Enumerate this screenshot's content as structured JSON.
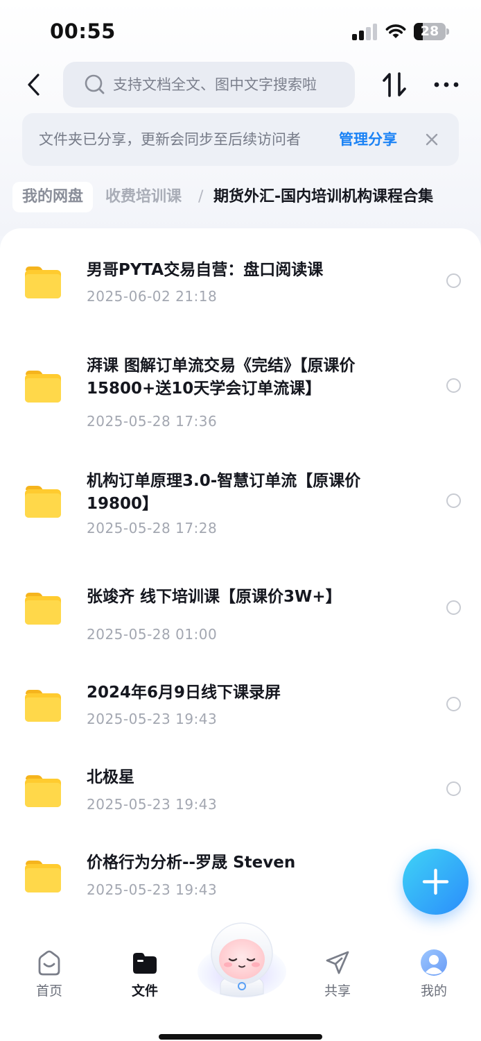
{
  "status_bar": {
    "time": "00:55",
    "battery": "28",
    "battery_level": 0.28
  },
  "search": {
    "placeholder": "支持文档全文、图中文字搜索啦"
  },
  "share_banner": {
    "message": "文件夹已分享，更新会同步至后续访问者",
    "action": "管理分享"
  },
  "breadcrumb": {
    "items": [
      {
        "label": "我的网盘"
      },
      {
        "label": "收费培训课"
      },
      {
        "label": "期货外汇-国内培训机构课程合集"
      }
    ],
    "separator": "/"
  },
  "files": [
    {
      "title": "男哥PYTA交易自营：盘口阅读课",
      "date": "2025-06-02 21:18"
    },
    {
      "title": "湃课 图解订单流交易《完结》【原课价15800+送10天学会订单流课】",
      "date": "2025-05-28 17:36"
    },
    {
      "title": "机构订单原理3.0-智慧订单流【原课价19800】",
      "date": "2025-05-28 17:28"
    },
    {
      "title": "张竣齐 线下培训课【原课价3W+】",
      "date": "2025-05-28 01:00"
    },
    {
      "title": "2024年6月9日线下课录屏",
      "date": "2025-05-23 19:43"
    },
    {
      "title": "北极星",
      "date": "2025-05-23 19:43"
    },
    {
      "title": "价格行为分析--罗晟 Steven",
      "date": "2025-05-23 19:43"
    }
  ],
  "tab_bar": {
    "tabs": [
      {
        "label": "首页",
        "icon": "home-icon"
      },
      {
        "label": "文件",
        "icon": "folder-icon"
      },
      {
        "label": "共享",
        "icon": "send-icon"
      },
      {
        "label": "我的",
        "icon": "avatar-icon"
      }
    ],
    "active": "文件"
  },
  "colors": {
    "accent": "#1a82f5",
    "folder": "#ffcb2f",
    "fab_start": "#3fd3f6",
    "fab_end": "#2b8dfb"
  }
}
